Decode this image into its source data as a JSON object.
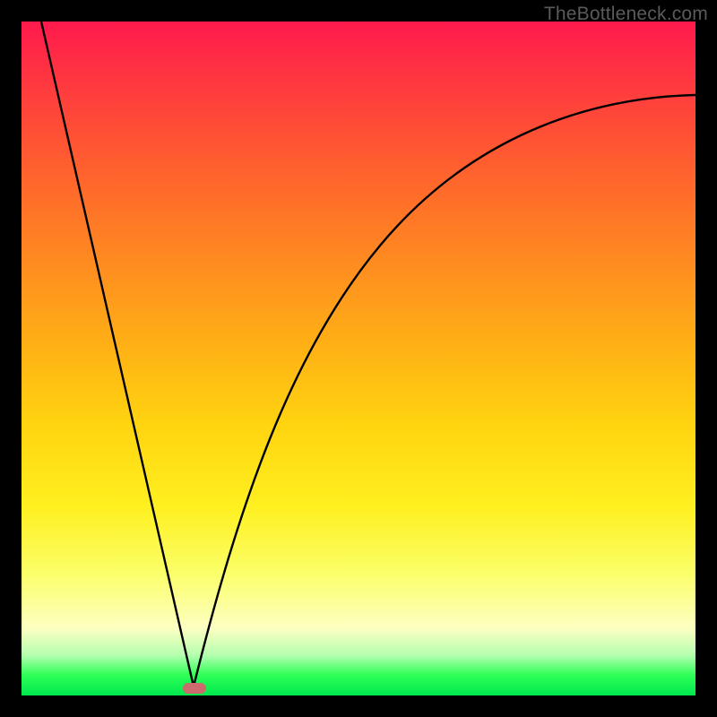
{
  "watermark": "TheBottleneck.com",
  "colors": {
    "gradient_top": "#ff1a4d",
    "gradient_bottom": "#00e84e",
    "curve": "#000000",
    "marker": "#cc6a6e",
    "frame_bg": "#000000"
  },
  "chart_data": {
    "type": "line",
    "title": "",
    "xlabel": "",
    "ylabel": "",
    "xlim": [
      0,
      100
    ],
    "ylim": [
      0,
      100
    ],
    "grid": false,
    "legend": false,
    "series": [
      {
        "name": "left-branch",
        "x": [
          3,
          7,
          12,
          16,
          20,
          23,
          25.5
        ],
        "y": [
          100,
          84,
          64,
          48,
          32,
          16,
          1
        ]
      },
      {
        "name": "right-branch",
        "x": [
          25.5,
          28,
          31,
          35,
          40,
          46,
          53,
          62,
          72,
          84,
          100
        ],
        "y": [
          1,
          12,
          25,
          38,
          50,
          60,
          68,
          75,
          81,
          85.5,
          89
        ]
      }
    ],
    "marker": {
      "x": 25.5,
      "y": 1,
      "shape": "pill"
    },
    "notes": "y expressed as percentage of plot height from bottom (0) to top (100); x as percentage of plot width from left (0) to right (100). Values are read off the figure by eye."
  }
}
